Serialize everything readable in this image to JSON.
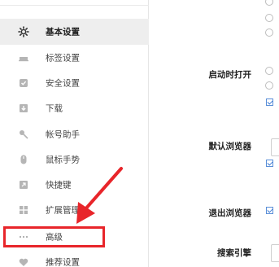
{
  "sidebar": {
    "items": [
      {
        "label": "基本设置",
        "icon": "gear-icon",
        "active": true
      },
      {
        "label": "标签设置",
        "icon": "tab-icon",
        "active": false
      },
      {
        "label": "安全设置",
        "icon": "shield-icon",
        "active": false
      },
      {
        "label": "下载",
        "icon": "download-icon",
        "active": false
      },
      {
        "label": "帐号助手",
        "icon": "key-icon",
        "active": false
      },
      {
        "label": "鼠标手势",
        "icon": "mouse-icon",
        "active": false
      },
      {
        "label": "快捷键",
        "icon": "shortcut-icon",
        "active": false
      },
      {
        "label": "扩展管理",
        "icon": "extension-icon",
        "active": false
      },
      {
        "label": "高级",
        "icon": "more-dots-icon",
        "active": false
      },
      {
        "label": "推荐设置",
        "icon": "heart-icon",
        "active": false
      }
    ]
  },
  "main": {
    "startup_label": "启动时打开",
    "default_browser_label": "默认浏览器",
    "exit_browser_label": "退出浏览器",
    "search_engine_label": "搜索引擎"
  },
  "colors": {
    "annotation": "#e8252a",
    "active_item_bg": "#eeeeee",
    "accent": "#3b78d1"
  }
}
